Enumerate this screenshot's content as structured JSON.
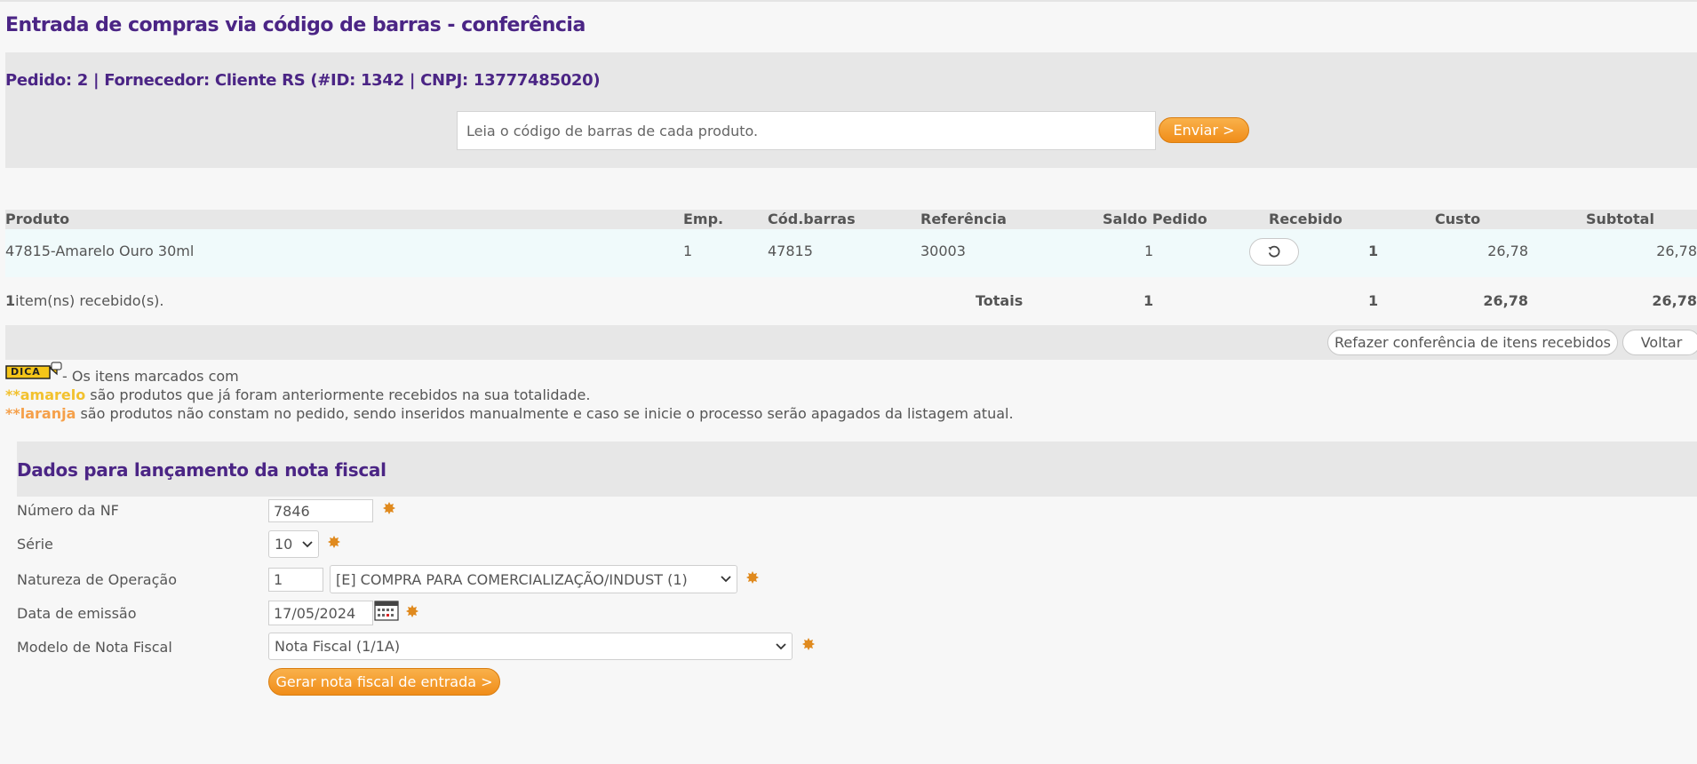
{
  "title": "Entrada de compras via código de barras - conferência",
  "order_info": "Pedido: 2 | Fornecedor: Cliente RS (#ID: 1342 | CNPJ: 13777485020)",
  "barcode": {
    "placeholder": "Leia o código de barras de cada produto.",
    "value": "",
    "send_label": "Enviar >"
  },
  "table": {
    "headers": {
      "produto": "Produto",
      "emp": "Emp.",
      "codbarras": "Cód.barras",
      "referencia": "Referência",
      "saldo": "Saldo Pedido",
      "recebido": "Recebido",
      "custo": "Custo",
      "subtotal": "Subtotal"
    },
    "rows": [
      {
        "produto": "47815-Amarelo Ouro 30ml",
        "emp": "1",
        "codbarras": "47815",
        "referencia": "30003",
        "saldo": "1",
        "recebido": "1",
        "custo": "26,78",
        "subtotal": "26,78"
      }
    ],
    "footer": {
      "count": "1",
      "count_label": "item(ns) recebido(s).",
      "totals_label": "Totais",
      "saldo": "1",
      "recebido": "1",
      "custo": "26,78",
      "subtotal": "26,78"
    }
  },
  "actions": {
    "redo_label": "Refazer conferência de itens recebidos",
    "back_label": "Voltar"
  },
  "tip": {
    "badge": "DICA",
    "intro": " - Os itens marcados com",
    "yellow_word": "**amarelo",
    "yellow_text": " são produtos que já foram anteriormente recebidos na sua totalidade.",
    "orange_word": "**laranja",
    "orange_text": " são produtos não constam no pedido, sendo inseridos manualmente e caso se inicie o processo serão apagados da listagem atual."
  },
  "nf": {
    "title": "Dados para lançamento da nota fiscal",
    "numero_label": "Número da NF",
    "numero_value": "7846",
    "serie_label": "Série",
    "serie_value": "10",
    "natureza_label": "Natureza de Operação",
    "natureza_code": "1",
    "natureza_value": "[E] COMPRA PARA COMERCIALIZAÇÃO/INDUST (1)",
    "data_label": "Data de emissão",
    "data_value": "17/05/2024",
    "modelo_label": "Modelo de Nota Fiscal",
    "modelo_value": "Nota Fiscal (1/1A)",
    "generate_label": "Gerar nota fiscal de entrada >"
  },
  "colors": {
    "title": "#4b2585",
    "orange_button": "#f29a27",
    "yellow": "#f2c12e",
    "orange": "#f5a04a",
    "panel": "#e7e7e7"
  },
  "icons": {
    "undo": "undo-icon",
    "calendar": "calendar-icon",
    "required": "required-icon",
    "dropdown": "chevron-down-icon"
  }
}
